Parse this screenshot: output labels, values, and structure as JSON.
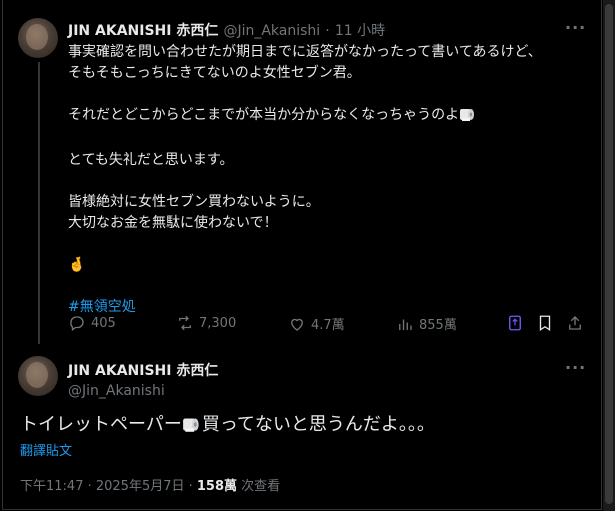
{
  "tweet": {
    "name": "JIN AKANISHI 赤西仁",
    "handle": "@Jin_Akanishi",
    "time_ago": "11 小時",
    "line1": "事実確認を問い合わせたが期日までに返答がなかったって書いてあるけど、",
    "line2": "そもそもこっちにきてないのよ女性セブン君。",
    "line3": "それだとどこからどこまでが本当か分からなくなっちゃうのよ",
    "line4": "とても失礼だと思います。",
    "line5": "皆様絶対に女性セブン買わないように。",
    "line6": "大切なお金を無駄に使わないで！",
    "emoji": "🤞",
    "hashtag": "#無領空処",
    "stats": {
      "replies": "405",
      "retweets": "7,300",
      "likes": "4.7萬",
      "views": "855萬"
    }
  },
  "reply": {
    "name": "JIN AKANISHI 赤西仁",
    "handle": "@Jin_Akanishi",
    "text_before": "トイレットペーパー",
    "text_after": "買ってないと思うんだよ。。。",
    "translate": "翻譯貼文",
    "timestamp": "下午11:47 · 2025年5月7日 · ",
    "views_count": "158萬",
    "views_label": " 次查看"
  },
  "colors": {
    "background": "#000000",
    "text": "#e7e9ea",
    "secondary": "#71767b",
    "link": "#1d9bf0",
    "bookmark": "#7856ff"
  },
  "icons": [
    "more-icon",
    "reply-icon",
    "retweet-icon",
    "like-icon",
    "views-icon",
    "grok-icon",
    "bookmark-icon",
    "share-icon",
    "toilet-paper-icon"
  ]
}
